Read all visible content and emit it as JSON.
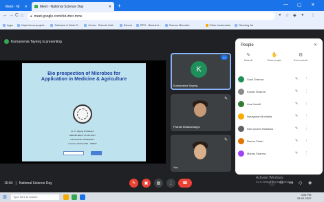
{
  "browser": {
    "tabs": [
      {
        "label": "Meet - Nt",
        "active": false
      },
      {
        "label": "Meet - National Science Day",
        "active": true
      }
    ],
    "new_tab": "+",
    "window_controls": [
      "—",
      "▢",
      "✕"
    ],
    "url": "meet.google.com/nkt-zbcr-mcw",
    "nav": [
      "←",
      "→",
      "C",
      "⌂"
    ],
    "bookmarks": [
      "Apps",
      "https://unor.project...",
      "Software & Work S...",
      "Home · Sciente Unit...",
      "School",
      "RPS - Biochimi...",
      "Roman Microbio...",
      "Other bookmarks",
      "Reading list"
    ]
  },
  "meet": {
    "presenting_text": "Kumarsenla Tayeng is presenting",
    "slide": {
      "title_line1": "Bio prospection of Microbes for",
      "title_line2": "Application in Medicine & Agriculture",
      "author": "Dr. K. Tayeng (Professor)",
      "dept": "DEPARTMENT OF BOTANY",
      "univ": "NAGALAND UNIVERSITY",
      "addr": "Lumami, NAGALAND - 798627"
    },
    "tiles": [
      {
        "initial": "K",
        "name": "Kumarsenla Tayeng",
        "avatar_color": "#1e8e5a"
      },
      {
        "name": "Pranab Bhattacharjya"
      },
      {
        "name": "You"
      }
    ],
    "meeting_time": "16:04",
    "separator": "|",
    "meeting_name": "National Science Day",
    "controls": [
      "mic-off",
      "camera-off",
      "captions",
      "present",
      "more",
      "end-call"
    ],
    "watermark_title": "Activate Windows",
    "watermark_sub": "Go to Settings to activate Windows."
  },
  "people_panel": {
    "title": "People",
    "close": "✕",
    "controls": [
      {
        "icon": "✎",
        "label": "Mute all"
      },
      {
        "icon": "✋",
        "label": "Raise people"
      },
      {
        "icon": "⚙",
        "label": "Host controls"
      }
    ],
    "participants": [
      {
        "name": "Sunil Sharma",
        "color": "#1e8e5a"
      },
      {
        "name": "Kumar Sharma",
        "color": "#8a8a8a"
      },
      {
        "name": "Lisa Hamilt",
        "color": "#2e7d32"
      },
      {
        "name": "Narayanan Bouhalla",
        "color": "#f9ab00"
      },
      {
        "name": "Ravi Queen Mahanta",
        "color": "#5f6368"
      },
      {
        "name": "Reena Chetri",
        "color": "#e37400"
      },
      {
        "name": "Manas Sharma",
        "color": "#a142f4"
      }
    ]
  },
  "taskbar": {
    "search_placeholder": "Type here to search",
    "time": "4:05 PM",
    "date": "28-02-2022"
  }
}
